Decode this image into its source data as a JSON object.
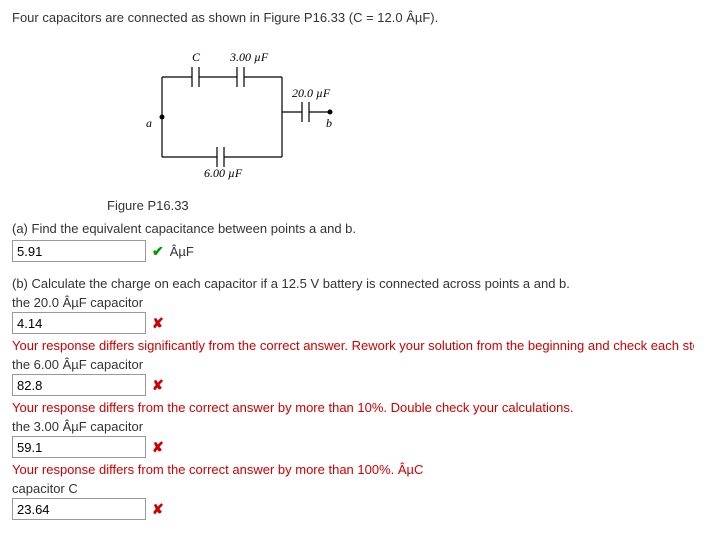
{
  "problem": {
    "statement": "Four capacitors are connected as shown in Figure P16.33 (C = 12.0 ÂµF).",
    "figure_caption": "Figure P16.33",
    "circuit_labels": {
      "C": "C",
      "c1": "3.00 µF",
      "c2": "20.0 µF",
      "c3": "6.00 µF",
      "node_a": "a",
      "node_b": "b"
    }
  },
  "part_a": {
    "prompt": "(a) Find the equivalent capacitance between points a and b.",
    "value": "5.91",
    "unit": "ÂµF",
    "correct": true
  },
  "part_b": {
    "prompt": "(b) Calculate the charge on each capacitor if a 12.5 V battery is connected across points a and b.",
    "items": [
      {
        "label": "the 20.0 ÂµF capacitor",
        "value": "4.14",
        "feedback": "Your response differs significantly from the correct answer. Rework your solution from the beginning and check each step carefully. ÂµC"
      },
      {
        "label": "the 6.00 ÂµF capacitor",
        "value": "82.8",
        "feedback": "Your response differs from the correct answer by more than 10%. Double check your calculations."
      },
      {
        "label": "the 3.00 ÂµF capacitor",
        "value": "59.1",
        "feedback": "Your response differs from the correct answer by more than 100%. ÂµC"
      },
      {
        "label": "capacitor C",
        "value": "23.64",
        "feedback": ""
      }
    ]
  }
}
